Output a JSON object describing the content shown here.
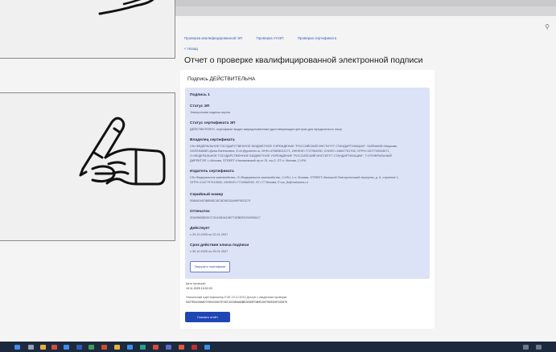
{
  "topnav": [
    "Проверка квалифицированной ЭП",
    "Проверка УНЭП",
    "Проверка сертификата"
  ],
  "back_label": "< Назад",
  "page_title": "Отчет о проверке квалифицированной электронной подписи",
  "card": {
    "heading": "Подпись ДЕЙСТВИТЕЛЬНА",
    "signature_label": "Подпись 1",
    "ep_status_label": "Статус ЭП",
    "ep_status_value": "Электронная подпись верна",
    "cert_status_label": "Статус сертификата ЭП",
    "cert_status_value": "ДЕЙСТВИТЕЛЕН, сертификат выдан аккредитованным удостоверяющим центром для юридического лица",
    "owner_label": "Владелец сертификата",
    "owner_lines": [
      "CN=ФЕДЕРАЛЬНОЕ ГОСУДАРСТВЕННОЕ БЮДЖЕТНОЕ УЧРЕЖДЕНИЕ \"РОССИЙСКИЙ ИНСТИТУТ СТАНДАРТИЗАЦИИ\", SURNAME=Маркова,",
      "GIVENNAME=Дина Евгеньевна, E=hr@gostinfo.ru, ИНН=470608011271, ИННЮЛ=7727964930, СНИЛС=16807751706, ОГРН=1207700043671,",
      "O=ФЕДЕРАЛЬНОЕ ГОСУДАРСТВЕННОЕ БЮДЖЕТНОЕ УЧРЕЖДЕНИЕ \"РОССИЙСКИЙ ИНСТИТУТ СТАНДАРТИЗАЦИИ\", T=ГЕНЕРАЛЬНЫЙ",
      "ДИРЕКТОР, L=Москва, STREET=Нахимовский пр-кт 31 стр.2, ST=г. Москва, C=RU"
    ],
    "issuer_label": "Издатель сертификата",
    "issuer_lines": [
      "CN=Федеральное казначейство, O=Федеральное казначейство, C=RU, L=г. Москва, STREET=Большой Златоустинский переулок, д. 6, строение 1,",
      "ОГРН=1047797019830, ИННЮЛ=7710568760, ST=77 Москва, E=uc_fk@roskazna.ru"
    ],
    "serial_label": "Серийный номер",
    "serial_value": "00884049788B0EC8C5D0E0DA99F9ED270",
    "thumbprint_label": "Отпечаток",
    "thumbprint_value": "2DA9B058D0CC31410DA108771EB0ED204SD617",
    "valid_label": "Действует",
    "valid_value": "с 29.10.2025 по 22.01.2027",
    "key_valid_label": "Срок действия ключа подписи",
    "key_valid_value": "с 30.10.2025 по 25.01.2027",
    "cert_button": "Загрузить сертификат",
    "check_date_label": "Дата проверки",
    "check_date_value": "19.11.2025 15:02:20",
    "check_id_label": "Уникальный идентификатор ЕЧЕ-19.12.2013 Доступ к сведениям проверки",
    "check_id_value": "9027E81046807295103407F0EC1EDB9ABBE3D59FDB9D3979DE54F220570",
    "download_button": "Скачать отчёт"
  },
  "colors": {
    "accent": "#1f46b5",
    "panel": "#dde3f6",
    "taskbar": "#1d2a3e"
  }
}
